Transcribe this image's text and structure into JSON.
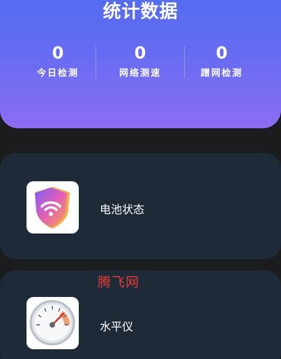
{
  "stats": {
    "title": "统计数据",
    "items": [
      {
        "value": "0",
        "label": "今日检测"
      },
      {
        "value": "0",
        "label": "网络测速"
      },
      {
        "value": "0",
        "label": "蹭网检测"
      }
    ]
  },
  "features": [
    {
      "label": "电池状态",
      "icon": "wifi-shield-icon"
    },
    {
      "label": "水平仪",
      "icon": "speedometer-icon"
    }
  ],
  "watermark": "腾飞网",
  "colors": {
    "header_gradient_start": "#4f6cf0",
    "header_gradient_end": "#8e6cf3",
    "card_bg": "#1f2a38",
    "page_bg": "#1b1c1e",
    "watermark": "#e53935"
  }
}
